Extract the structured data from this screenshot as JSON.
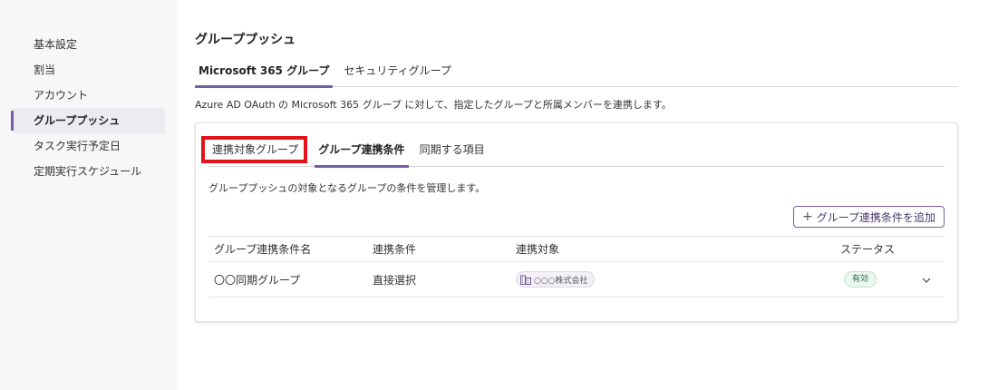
{
  "sidebar": {
    "items": [
      {
        "label": "基本設定"
      },
      {
        "label": "割当"
      },
      {
        "label": "アカウント"
      },
      {
        "label": "グループプッシュ"
      },
      {
        "label": "タスク実行予定日"
      },
      {
        "label": "定期実行スケジュール"
      }
    ],
    "active_index": 3,
    "accent_color": "#7a5aa6"
  },
  "main": {
    "title": "グループプッシュ",
    "tabs": [
      {
        "label": "Microsoft 365 グループ",
        "active": true
      },
      {
        "label": "セキュリティグループ",
        "active": false
      }
    ],
    "description": "Azure AD OAuth の Microsoft 365 グループ に対して、指定したグループと所属メンバーを連携します。",
    "card": {
      "tabs": [
        {
          "label": "連携対象グループ",
          "highlighted": true
        },
        {
          "label": "グループ連携条件",
          "active": true
        },
        {
          "label": "同期する項目"
        }
      ],
      "description": "グループプッシュの対象となるグループの条件を管理します。",
      "add_button": {
        "icon": "plus-icon",
        "label": "グループ連携条件を追加"
      },
      "table": {
        "headers": [
          "グループ連携条件名",
          "連携条件",
          "連携対象",
          "ステータス",
          ""
        ],
        "rows": [
          {
            "name": "〇〇同期グループ",
            "condition": "直接選択",
            "target_icon": "building-icon",
            "target": "○○○株式会社",
            "status": "有効",
            "status_color": "#2b6b44"
          }
        ]
      }
    }
  },
  "highlight_color": "#e1141c"
}
